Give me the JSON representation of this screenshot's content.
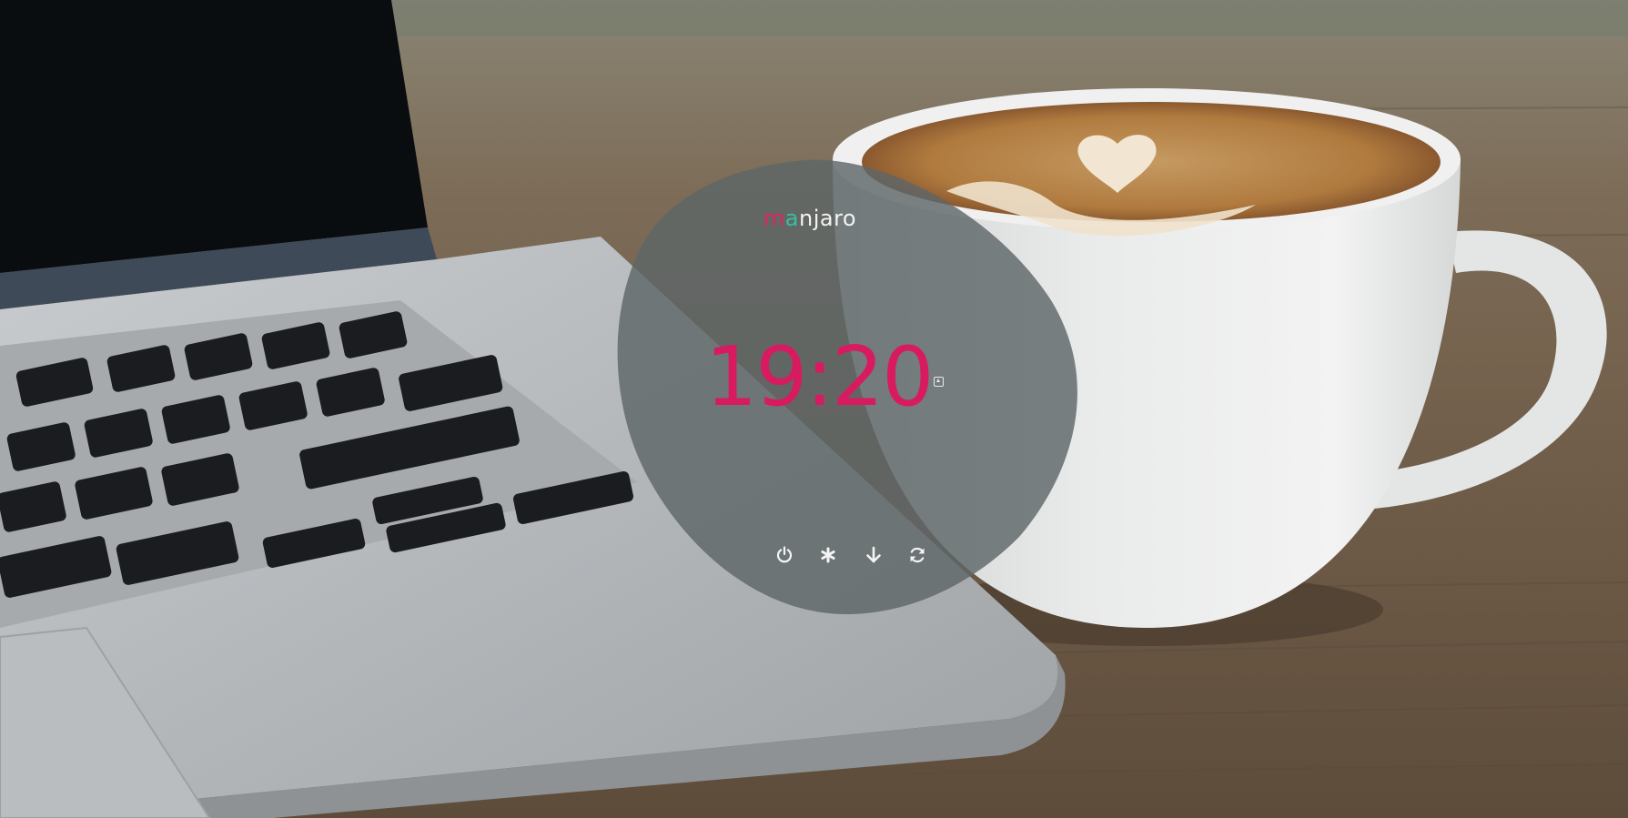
{
  "lockscreen": {
    "logo": {
      "part1": "ma",
      "part2": "njaro",
      "colors": {
        "m": "#e0245e",
        "a": "#35bfa4",
        "rest": "#f2f2f2"
      }
    },
    "clock": {
      "time": "19:20",
      "color": "#d81b60"
    },
    "keyboard_indicator_icon": "keyboard-layout-icon",
    "actions": [
      {
        "id": "power",
        "icon": "power-icon"
      },
      {
        "id": "settings",
        "icon": "asterisk-icon"
      },
      {
        "id": "suspend",
        "icon": "arrow-down-icon"
      },
      {
        "id": "restart",
        "icon": "refresh-icon"
      }
    ],
    "overlay_color": "#5e6668"
  }
}
